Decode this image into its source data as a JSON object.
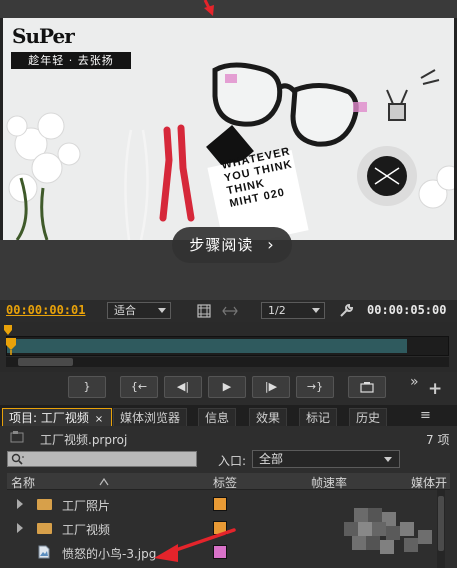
{
  "monitor": {
    "logo_text": "SuPer",
    "slogan": "趁年轻 · 去张扬",
    "notebook_text": "WHATEVER YOU THINK THINK MIHT 020",
    "read_button": "步骤阅读",
    "read_button_chevron": "›"
  },
  "time_row": {
    "current_timecode": "00:00:00:01",
    "fit_label": "适合",
    "resolution_label": "1/2",
    "duration_timecode": "00:00:05:00"
  },
  "transport": {
    "mark_in": "{",
    "mark_out": "}",
    "go_to_in": "{←",
    "step_back": "◀|",
    "play": "▶",
    "step_forward": "|▶",
    "go_to_out": "→}",
    "overflow": "»",
    "add": "+"
  },
  "tabs": [
    {
      "label": "项目: 工厂视频",
      "close": "×"
    },
    {
      "label": "媒体浏览器"
    },
    {
      "label": "信息"
    },
    {
      "label": "效果"
    },
    {
      "label": "标记"
    },
    {
      "label": "历史"
    }
  ],
  "tab_menu": "≡",
  "project": {
    "file_name": "工厂视频.prproj",
    "item_count": "7 项",
    "entry_label": "入口:",
    "entry_value": "全部",
    "columns": {
      "name": "名称",
      "label": "标签",
      "frame_rate": "帧速率",
      "media_start": "媒体开"
    },
    "items": [
      {
        "name": "工厂照片",
        "type": "bin",
        "label_color": "#e89a35"
      },
      {
        "name": "工厂视频",
        "type": "bin",
        "label_color": "#e89a35"
      },
      {
        "name": "愤怒的小鸟-3.jpg",
        "type": "image",
        "label_color": "#d872c8"
      }
    ]
  },
  "colors": {
    "accent_timecode": "#e8a20a",
    "annotation_arrow": "#e4242b",
    "timeline_fill": "#2f5a5e"
  }
}
